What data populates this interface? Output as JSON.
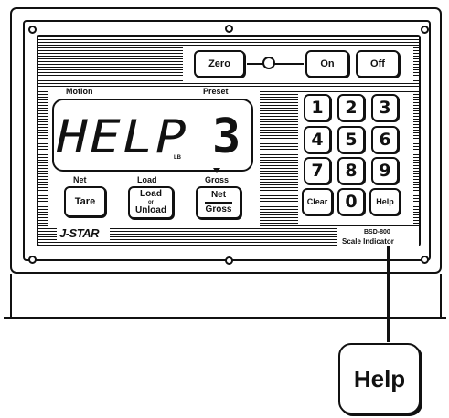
{
  "device": {
    "brand": "J-STAR",
    "model_code": "BSD-800",
    "model_name": "Scale Indicator"
  },
  "display": {
    "text": "HELP",
    "digit": "3",
    "unit_mark": "LB",
    "labels": {
      "motion": "Motion",
      "preset": "Preset",
      "net": "Net",
      "load": "Load",
      "gross": "Gross"
    }
  },
  "buttons": {
    "zero": "Zero",
    "on": "On",
    "off": "Off",
    "tare": "Tare",
    "load_unload_top": "Load",
    "load_unload_mid": "or",
    "load_unload_bottom": "Unload",
    "net_gross_top": "Net",
    "net_gross_bottom": "Gross"
  },
  "keypad": {
    "row1": [
      "1",
      "2",
      "3"
    ],
    "row2": [
      "4",
      "5",
      "6"
    ],
    "row3": [
      "7",
      "8",
      "9"
    ],
    "clear": "Clear",
    "zero": "0",
    "help": "Help"
  },
  "callout": {
    "label": "Help"
  }
}
